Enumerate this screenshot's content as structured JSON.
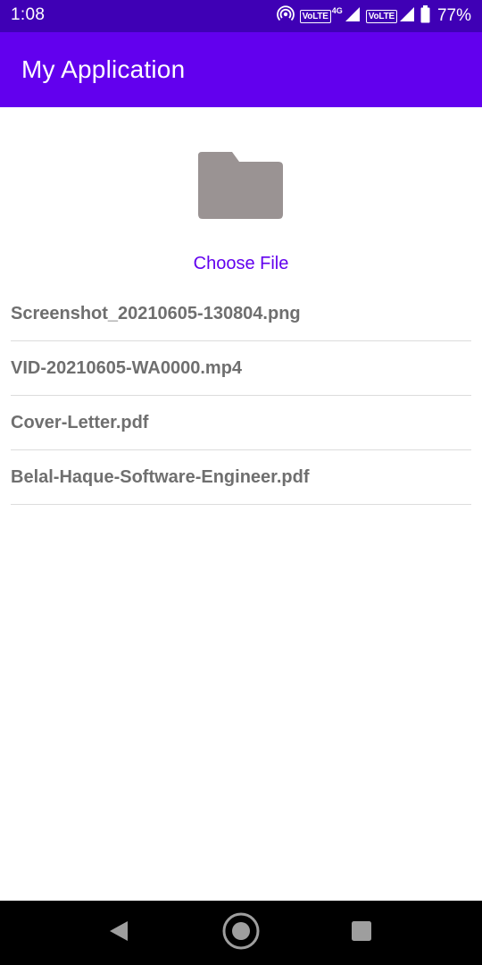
{
  "status_bar": {
    "time": "1:08",
    "volte_label": "VoLTE",
    "network_tag": "4G",
    "battery_percent": "77%",
    "background": "#3f00b5"
  },
  "app_bar": {
    "title": "My Application",
    "background": "#6200ee"
  },
  "main": {
    "folder_icon": "folder-icon",
    "folder_color": "#9a9393",
    "choose_file_label": "Choose File",
    "files": [
      {
        "name": "Screenshot_20210605-130804.png"
      },
      {
        "name": "VID-20210605-WA0000.mp4"
      },
      {
        "name": "Cover-Letter.pdf"
      },
      {
        "name": "Belal-Haque-Software-Engineer.pdf"
      }
    ]
  },
  "nav_bar": {
    "back_icon": "back-triangle-icon",
    "home_icon": "home-circle-icon",
    "recents_icon": "recents-square-icon"
  }
}
